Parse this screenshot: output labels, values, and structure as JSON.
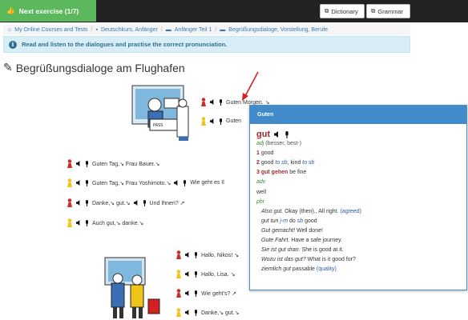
{
  "topbar": {
    "next_label": "Next exercise (1/7)",
    "dictionary_label": "Dictionary",
    "grammar_label": "Grammar"
  },
  "breadcrumb": [
    "My Online Courses and Tests",
    "Deutschkurs, Anfänger",
    "Anfänger Teil 1",
    "Begrüßungsdialoge, Vorstellung, Berufe"
  ],
  "info": {
    "text": "Read and listen to the dialogues and practise the correct pronunciation."
  },
  "page": {
    "title": "Begrüßungsdialoge am Flughafen"
  },
  "colors": {
    "red_pawn": "#c9302c",
    "yellow_pawn": "#f0c419",
    "green": "#5cb85c",
    "blue": "#428bca"
  },
  "dialog1": [
    {
      "speaker": "red",
      "text": "Guten Morgen. ↘"
    },
    {
      "speaker": "yellow",
      "text": "Guten"
    }
  ],
  "dialog2": [
    {
      "speaker": "red",
      "text": "Guten Tag,↘ Frau Bauer.↘"
    },
    {
      "speaker": "yellow",
      "text": "Guten Tag,↘ Frau Yoshimoto.↘",
      "text2": "Wie geht es Il"
    },
    {
      "speaker": "red",
      "text": "Danke,↘ gut.↘",
      "text2": "Und Ihnen? ↗"
    },
    {
      "speaker": "yellow",
      "text": "Auch gut,↘ danke.↘"
    }
  ],
  "dialog3": [
    {
      "speaker": "red",
      "text": "Hallo, Nikos! ↘"
    },
    {
      "speaker": "yellow",
      "text": "Hallo, Lisa. ↘"
    },
    {
      "speaker": "red",
      "text": "Wie geht's? ↗"
    },
    {
      "speaker": "yellow",
      "text": "Danke,↘ gut.↘"
    }
  ],
  "popup": {
    "header": "Guten",
    "lemma": "gut",
    "pos_adj": "adj",
    "adj_forms": "(besser, best-)",
    "senses": [
      {
        "n": "1",
        "text": "good"
      },
      {
        "n": "2",
        "pre": "good",
        "it1": "to sb",
        "mid": ", kind",
        "it2": "to sb"
      },
      {
        "n": "3",
        "bold": "gut gehen",
        "text": "be fine"
      }
    ],
    "pos_adv": "adv",
    "adv_text": "well",
    "pos_phr": "phr",
    "phrases": [
      {
        "de": "Also gut.",
        "en": "Okay (then)., All right.",
        "note": "(agreed)"
      },
      {
        "de": "gut tun",
        "it": "j-m",
        "mid": " do ",
        "it2": "sb",
        "en": " good"
      },
      {
        "de": "Gut gemacht!",
        "en": "Well done!"
      },
      {
        "de": "Gute Fahrt.",
        "en": "Have a safe journey."
      },
      {
        "de": "Sie ist gut dran.",
        "en": "She is good at it."
      },
      {
        "de": "Wozu ist das gut?",
        "en": "What is it good for?"
      },
      {
        "de": "ziemlich gut",
        "en": "passable",
        "note": "(quality)"
      }
    ]
  }
}
